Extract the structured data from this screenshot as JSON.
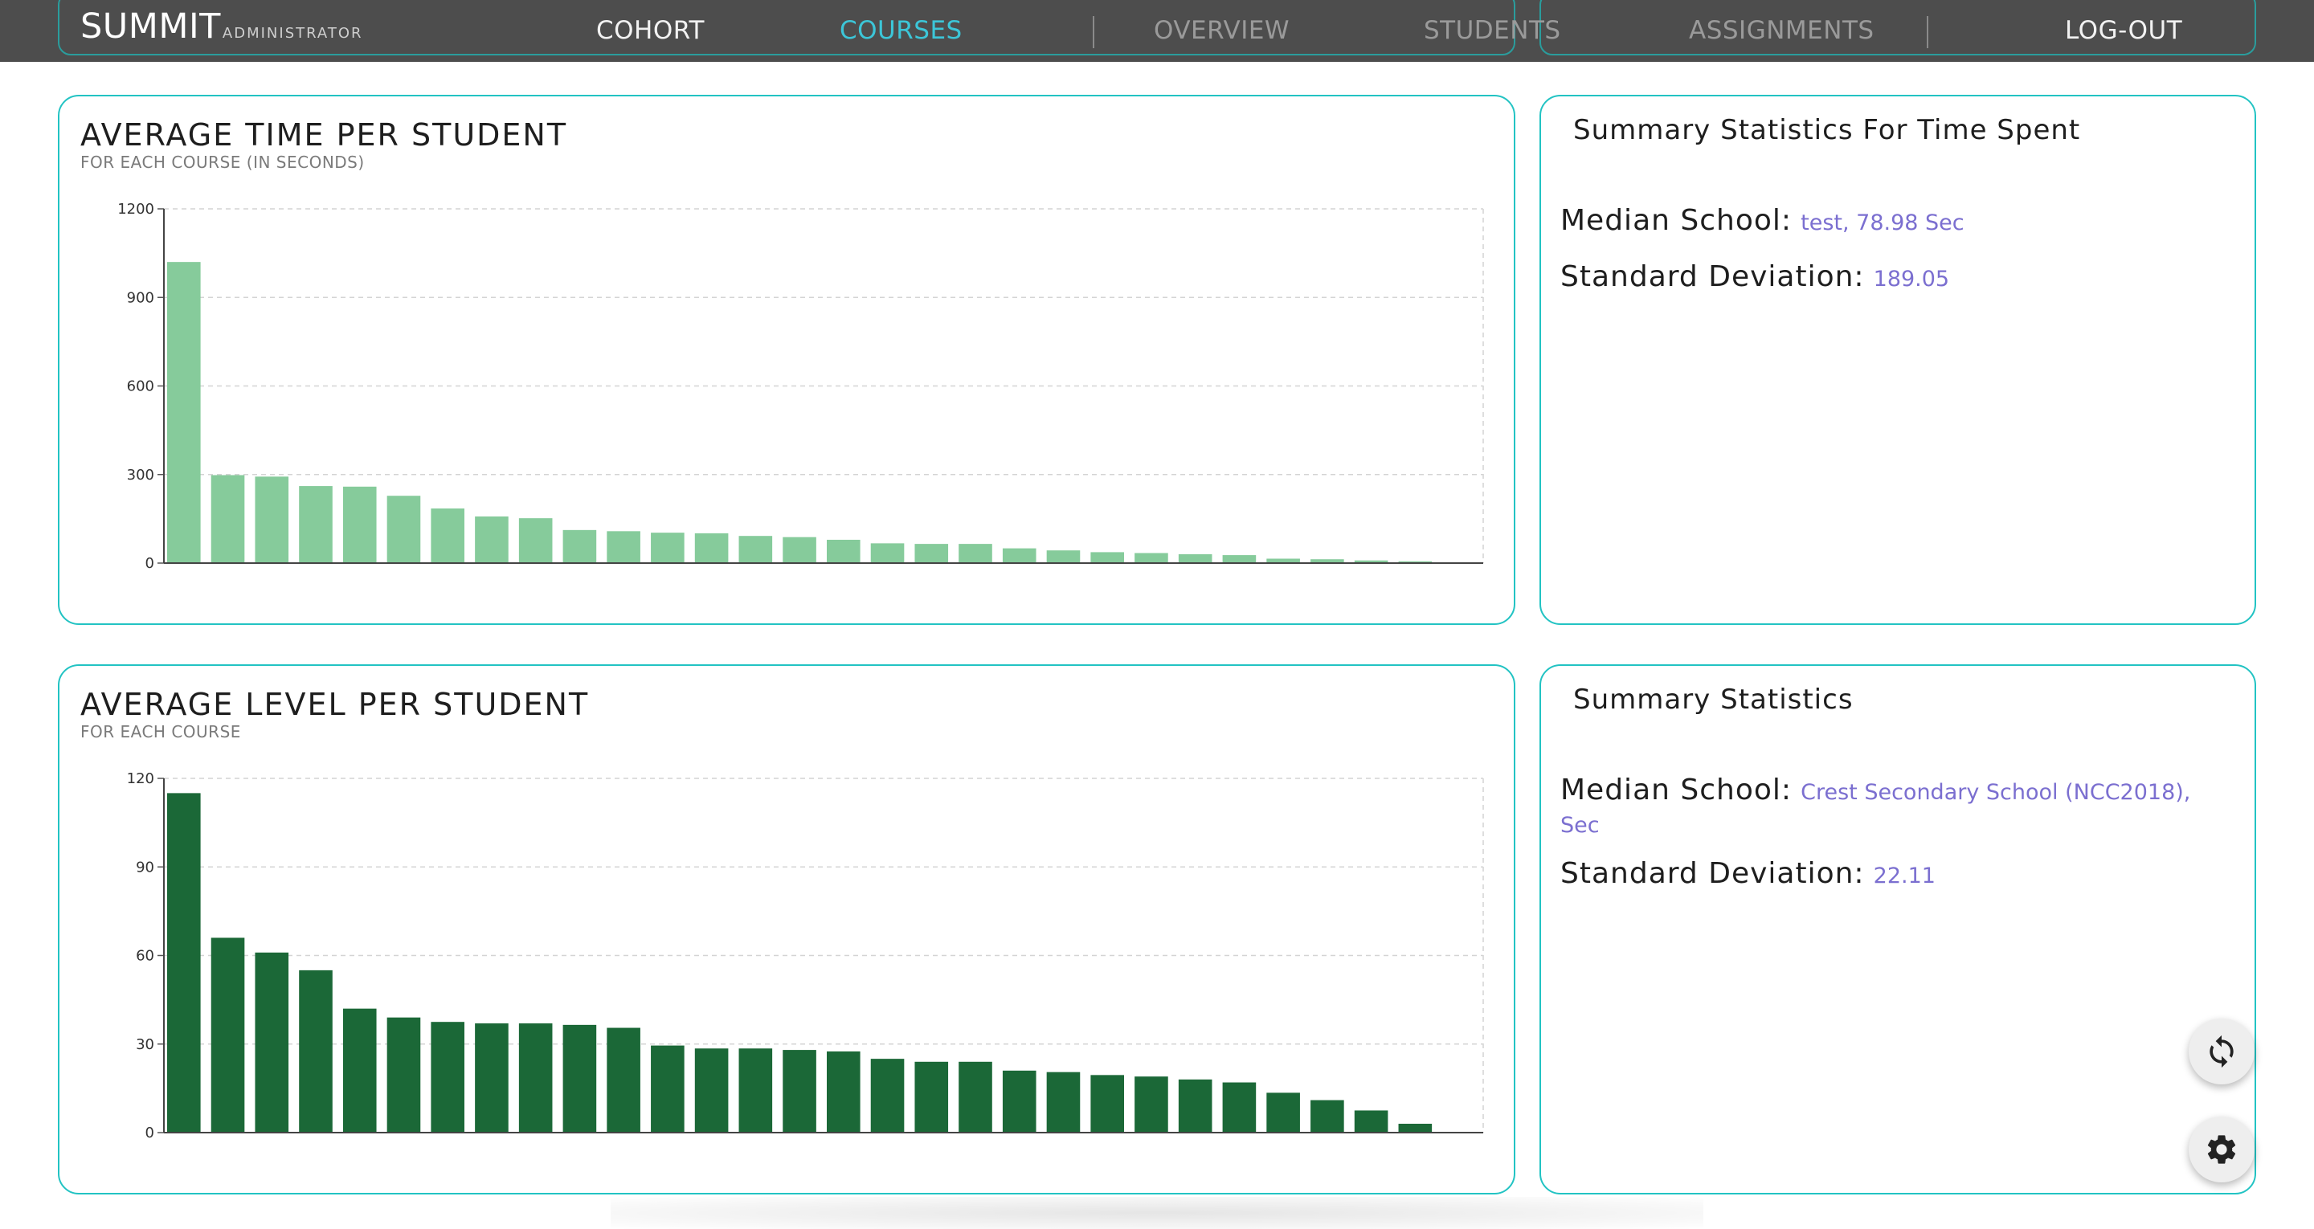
{
  "nav": {
    "brand": "SUMMIT",
    "brand_sub": "ADMINISTRATOR",
    "links": {
      "cohort": "COHORT",
      "courses": "COURSES",
      "overview": "OVERVIEW",
      "students": "STUDENTS",
      "assignments": "ASSIGNMENTS",
      "logout": "LOG-OUT"
    },
    "colors": {
      "active": "#3cc6d8",
      "bar": "#4d4d4d",
      "frame": "#2a9d9d"
    }
  },
  "time_card": {
    "title": "AVERAGE TIME PER STUDENT",
    "subtitle": "FOR EACH COURSE (IN SECONDS)"
  },
  "level_card": {
    "title": "AVERAGE LEVEL PER STUDENT",
    "subtitle": "FOR EACH COURSE"
  },
  "time_stats": {
    "title": "Summary Statistics For Time Spent",
    "median_label": "Median School:",
    "median_value": "test, 78.98 Sec",
    "sd_label": "Standard Deviation:",
    "sd_value": "189.05"
  },
  "level_stats": {
    "title": "Summary Statistics",
    "median_label": "Median School:",
    "median_value": "Crest Secondary School (NCC2018), Sec",
    "sd_label": "Standard Deviation:",
    "sd_value": "22.11"
  },
  "buttons": {
    "refresh_icon": "refresh-icon",
    "settings_icon": "gear-icon"
  },
  "chart_data": [
    {
      "type": "bar",
      "title": "AVERAGE TIME PER STUDENT",
      "subtitle": "FOR EACH COURSE (IN SECONDS)",
      "color": "#86cb9b",
      "ylim": [
        0,
        1200
      ],
      "yticks": [
        0,
        300,
        600,
        900,
        1200
      ],
      "grid": true,
      "values": [
        1020,
        298,
        293,
        261,
        259,
        228,
        185,
        158,
        152,
        112,
        108,
        103,
        101,
        92,
        88,
        79,
        67,
        65,
        65,
        50,
        43,
        37,
        34,
        30,
        27,
        15,
        13,
        9,
        6
      ]
    },
    {
      "type": "bar",
      "title": "AVERAGE LEVEL PER STUDENT",
      "subtitle": "FOR EACH COURSE",
      "color": "#1b6837",
      "ylim": [
        0,
        120
      ],
      "yticks": [
        0,
        30,
        60,
        90,
        120
      ],
      "grid": true,
      "values": [
        115,
        66,
        61,
        55,
        42,
        39,
        37.5,
        37,
        37,
        36.5,
        35.5,
        29.5,
        28.5,
        28.5,
        28,
        27.5,
        25,
        24,
        24,
        21,
        20.5,
        19.5,
        19,
        18,
        17,
        13.5,
        11,
        7.5,
        3
      ]
    }
  ]
}
